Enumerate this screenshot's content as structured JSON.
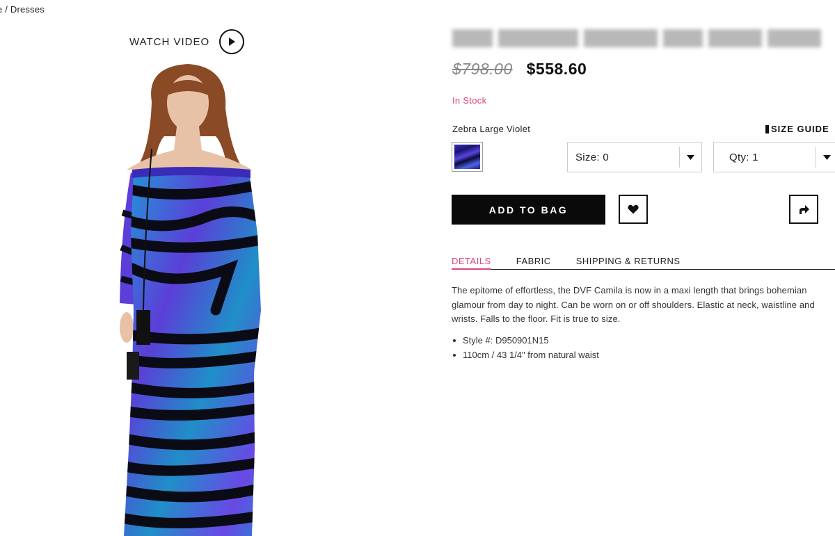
{
  "breadcrumb": "e / Dresses",
  "media": {
    "watch_video_label": "WATCH VIDEO",
    "play_icon": "play-circle-icon",
    "product_image_alt": "Model wearing a long-sleeve off-shoulder maxi dress in blue, violet and black zebra print"
  },
  "product": {
    "old_price": "$798.00",
    "price": "$558.60",
    "stock_status": "In Stock",
    "color_name": "Zebra Large Violet",
    "size_guide_label": "SIZE GUIDE",
    "size_select_value": "Size: 0",
    "qty_select_value": "Qty: 1",
    "add_to_bag_label": "ADD TO BAG",
    "wishlist_icon": "heart-icon",
    "share_icon": "share-arrow-icon"
  },
  "tabs": [
    {
      "label": "DETAILS",
      "active": true
    },
    {
      "label": "FABRIC",
      "active": false
    },
    {
      "label": "SHIPPING & RETURNS",
      "active": false
    }
  ],
  "details": {
    "description": "The epitome of effortless, the DVF Camila is now in a maxi length that brings bohemian glamour from day to night. Can be worn on or off shoulders. Elastic at neck, waistline and wrists. Falls to the floor. Fit is true to size.",
    "bullets": [
      "Style #: D950901N15",
      "110cm / 43 1/4\" from natural waist"
    ]
  },
  "colors": {
    "accent_pink": "#e0447a",
    "button_black": "#0a0a0a",
    "dress_blue": "#1f8fc8",
    "dress_violet": "#5a3fd6"
  }
}
